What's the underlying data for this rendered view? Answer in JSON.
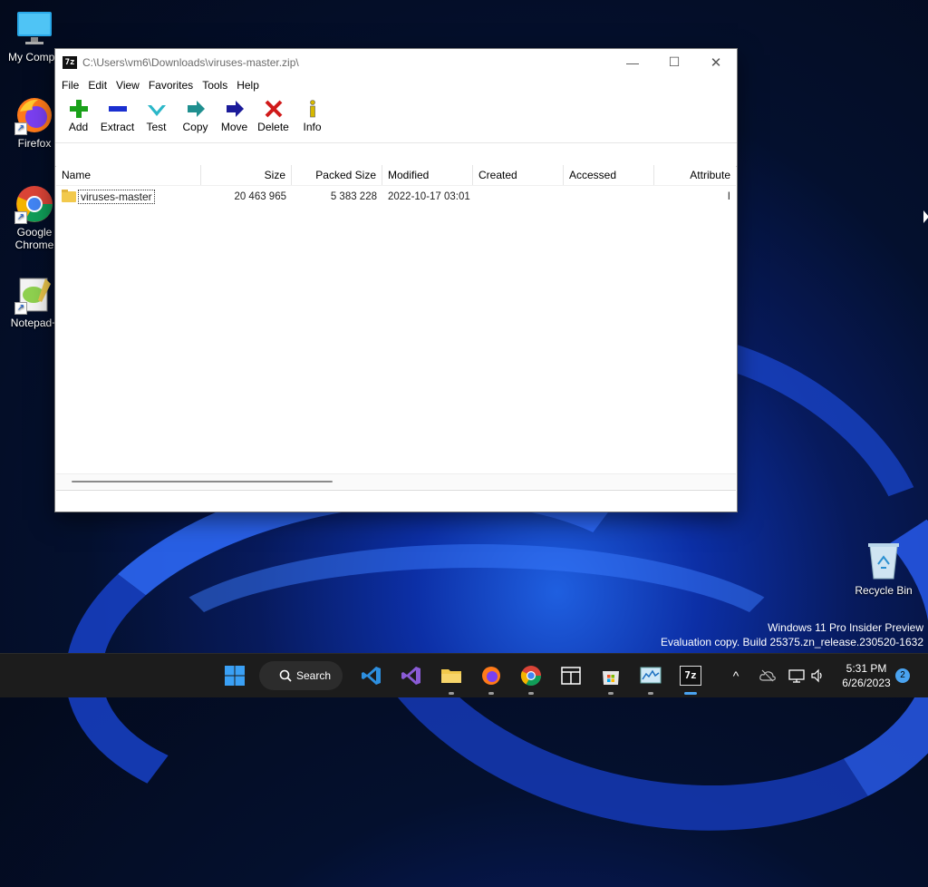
{
  "desktop": {
    "icons": [
      {
        "label": "My Compu"
      },
      {
        "label": "Firefox"
      },
      {
        "label": "Google Chrome"
      },
      {
        "label": "Notepad+"
      }
    ],
    "recycle_bin": "Recycle Bin",
    "watermark_line1": "Windows 11 Pro Insider Preview",
    "watermark_line2": "Evaluation copy. Build 25375.zn_release.230520-1632"
  },
  "window": {
    "app_icon_text": "7z",
    "title": "C:\\Users\\vm6\\Downloads\\viruses-master.zip\\",
    "minimize": "—",
    "maximize": "☐",
    "close": "✕",
    "menu": [
      "File",
      "Edit",
      "View",
      "Favorites",
      "Tools",
      "Help"
    ],
    "toolbar": [
      {
        "label": "Add",
        "icon": "plus-icon",
        "color": "#1aa11a"
      },
      {
        "label": "Extract",
        "icon": "minus-icon",
        "color": "#1a2fd0"
      },
      {
        "label": "Test",
        "icon": "check-icon",
        "color": "#2bb7c8"
      },
      {
        "label": "Copy",
        "icon": "copy-arrow-icon",
        "color": "#1f8f8f"
      },
      {
        "label": "Move",
        "icon": "move-arrow-icon",
        "color": "#1b1b9a"
      },
      {
        "label": "Delete",
        "icon": "delete-x-icon",
        "color": "#d01a1a"
      },
      {
        "label": "Info",
        "icon": "info-icon",
        "color": "#d6b800"
      }
    ],
    "columns": [
      "Name",
      "Size",
      "Packed Size",
      "Modified",
      "Created",
      "Accessed",
      "Attribute"
    ],
    "rows": [
      {
        "name": "viruses-master",
        "size": "20 463 965",
        "packed": "5 383 228",
        "modified": "2022-10-17 03:01",
        "created": "",
        "accessed": "",
        "attr": "I"
      }
    ]
  },
  "taskbar": {
    "search_label": "Search",
    "time": "5:31 PM",
    "date": "6/26/2023",
    "notification_count": "2"
  }
}
